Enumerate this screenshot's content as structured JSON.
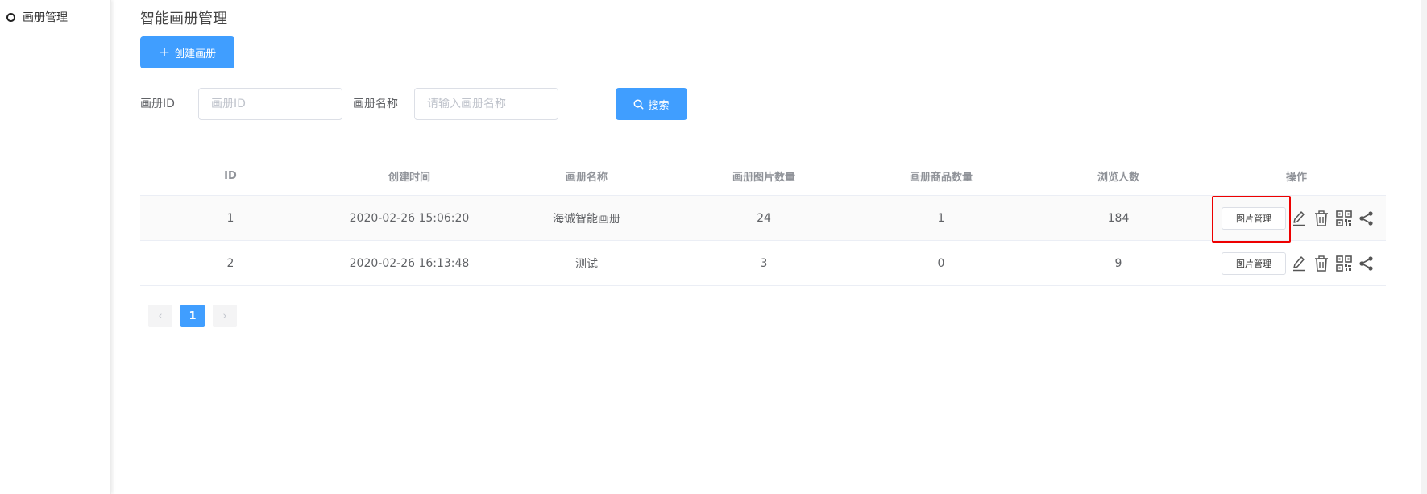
{
  "sidebar": {
    "items": [
      {
        "label": "画册管理"
      }
    ]
  },
  "page": {
    "title": "智能画册管理",
    "create_label": "创建画册"
  },
  "filters": {
    "id_label": "画册ID",
    "id_placeholder": "画册ID",
    "id_value": "",
    "name_label": "画册名称",
    "name_placeholder": "请输入画册名称",
    "name_value": "",
    "search_label": "搜索"
  },
  "table": {
    "columns": [
      "ID",
      "创建时间",
      "画册名称",
      "画册图片数量",
      "画册商品数量",
      "浏览人数",
      "操作"
    ],
    "rows": [
      {
        "id": "1",
        "created": "2020-02-26 15:06:20",
        "name": "海诚智能画册",
        "pics": "24",
        "goods": "1",
        "views": "184",
        "action_label": "图片管理"
      },
      {
        "id": "2",
        "created": "2020-02-26 16:13:48",
        "name": "测试",
        "pics": "3",
        "goods": "0",
        "views": "9",
        "action_label": "图片管理"
      }
    ]
  },
  "pagination": {
    "prev": "‹",
    "current": "1",
    "next": "›"
  },
  "colors": {
    "primary": "#409eff",
    "highlight": "#ee0000"
  },
  "icons": [
    "plus-icon",
    "search-icon",
    "edit-icon",
    "delete-icon",
    "qrcode-icon",
    "share-icon"
  ]
}
